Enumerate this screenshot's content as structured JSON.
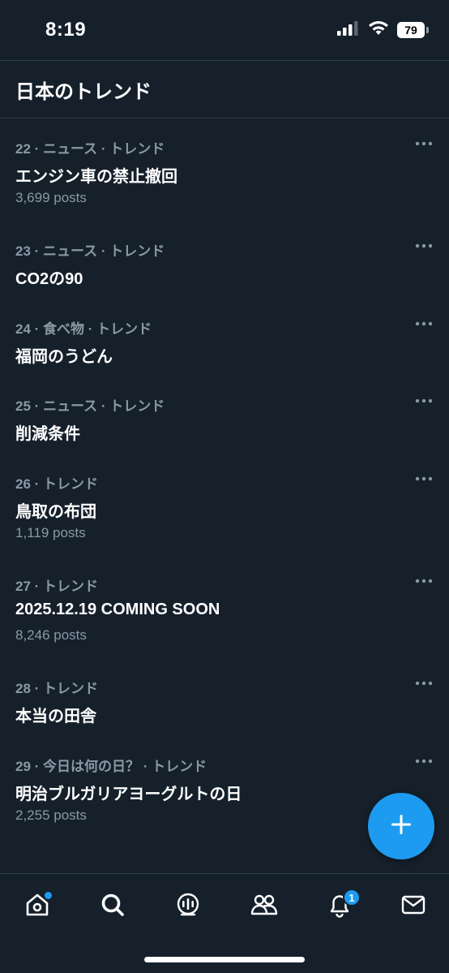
{
  "status_bar": {
    "time": "8:19",
    "battery": "79",
    "icons": [
      "signal-icon",
      "wifi-icon",
      "battery-icon"
    ]
  },
  "header": {
    "title": "日本のトレンド"
  },
  "trends": [
    {
      "meta": "22 · ニュース · トレンド",
      "title": "エンジン車の禁止撤回",
      "posts": "3,699 posts"
    },
    {
      "meta": "23 · ニュース · トレンド",
      "title": "CO2の90",
      "posts": ""
    },
    {
      "meta": "24 · 食べ物 · トレンド",
      "title": "福岡のうどん",
      "posts": ""
    },
    {
      "meta": "25 · ニュース · トレンド",
      "title": "削減条件",
      "posts": ""
    },
    {
      "meta": "26 · トレンド",
      "title": "鳥取の布団",
      "posts": "1,119 posts"
    },
    {
      "meta": "27 · トレンド",
      "title": "2025.12.19 COMING SOON",
      "posts": "8,246 posts"
    },
    {
      "meta": "28 · トレンド",
      "title": "本当の田舎",
      "posts": ""
    },
    {
      "meta": "29 · 今日は何の日？ · トレンド",
      "title": "明治ブルガリアヨーグルトの日",
      "posts": "2,255 posts"
    }
  ],
  "fab": {
    "icon": "plus-icon"
  },
  "bottom_nav": {
    "items": [
      "home-icon",
      "search-icon",
      "spaces-icon",
      "communities-icon",
      "notifications-icon",
      "messages-icon"
    ],
    "notification_count": "1"
  },
  "colors": {
    "background": "#15202b",
    "accent": "#1d9bf0",
    "secondary_text": "#8b98a5",
    "divider": "#2f3b47"
  }
}
